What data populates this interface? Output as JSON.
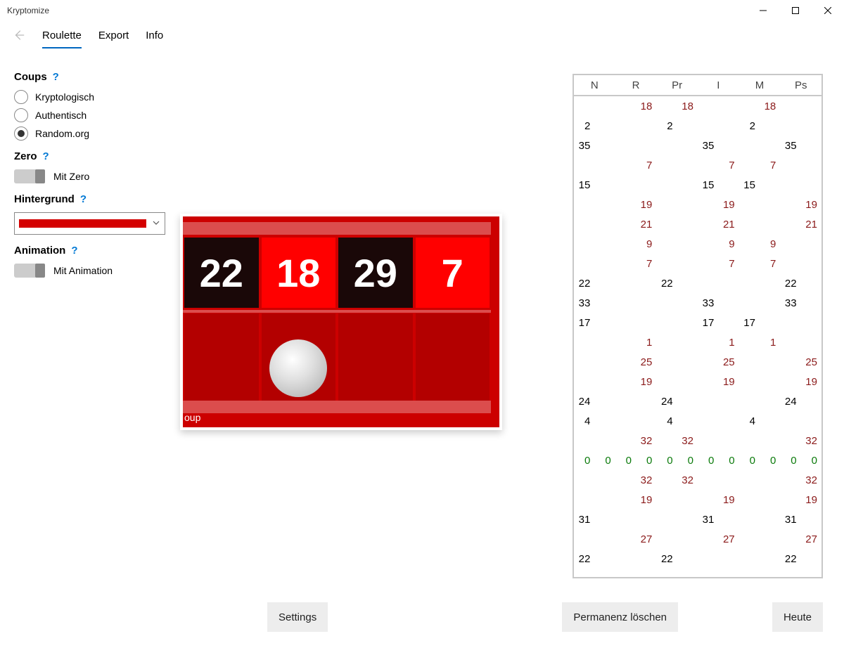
{
  "app_title": "Kryptomize",
  "tabs": [
    "Roulette",
    "Export",
    "Info"
  ],
  "active_tab": 0,
  "sidebar": {
    "coups": {
      "title": "Coups",
      "options": [
        "Kryptologisch",
        "Authentisch",
        "Random.org"
      ],
      "selected": 2
    },
    "zero": {
      "title": "Zero",
      "toggle_label": "Mit Zero",
      "enabled": false
    },
    "background": {
      "title": "Hintergrund",
      "color": "#d40000"
    },
    "animation": {
      "title": "Animation",
      "toggle_label": "Mit Animation",
      "enabled": false
    }
  },
  "roulette_strip": {
    "cells": [
      {
        "n": "22",
        "color": "black"
      },
      {
        "n": "18",
        "color": "red"
      },
      {
        "n": "29",
        "color": "black"
      },
      {
        "n": "7",
        "color": "red"
      }
    ],
    "ball_index": 1,
    "label_fragment": "oup"
  },
  "table": {
    "headers": [
      "N",
      "R",
      "Pr",
      "I",
      "M",
      "Ps"
    ],
    "rows": [
      [
        "",
        "18",
        "18",
        "",
        "18",
        ""
      ],
      [
        "2",
        "",
        "2",
        "",
        "2",
        ""
      ],
      [
        "35",
        "",
        "",
        "35",
        "",
        "35"
      ],
      [
        "",
        "7",
        "",
        "7",
        "7",
        ""
      ],
      [
        "15",
        "",
        "",
        "15",
        "15",
        ""
      ],
      [
        "",
        "19",
        "",
        "19",
        "",
        "19"
      ],
      [
        "",
        "21",
        "",
        "21",
        "",
        "21"
      ],
      [
        "",
        "9",
        "",
        "9",
        "9",
        ""
      ],
      [
        "",
        "7",
        "",
        "7",
        "7",
        ""
      ],
      [
        "22",
        "",
        "22",
        "",
        "",
        "22"
      ],
      [
        "33",
        "",
        "",
        "33",
        "",
        "33"
      ],
      [
        "17",
        "",
        "",
        "17",
        "17",
        ""
      ],
      [
        "",
        "1",
        "",
        "1",
        "1",
        ""
      ],
      [
        "",
        "25",
        "",
        "25",
        "",
        "25"
      ],
      [
        "",
        "19",
        "",
        "19",
        "",
        "19"
      ],
      [
        "24",
        "",
        "24",
        "",
        "",
        "24"
      ],
      [
        "4",
        "",
        "4",
        "",
        "4",
        ""
      ],
      [
        "",
        "32",
        "32",
        "",
        "",
        "32"
      ],
      [
        "0g",
        "0g",
        "0g",
        "0g",
        "0g",
        "0g"
      ],
      [
        "",
        "32",
        "32",
        "",
        "",
        "32"
      ],
      [
        "",
        "19",
        "",
        "19",
        "",
        "19"
      ],
      [
        "31",
        "",
        "",
        "31",
        "",
        "31"
      ],
      [
        "",
        "27",
        "",
        "27",
        "",
        "27"
      ],
      [
        "22",
        "",
        "22",
        "",
        "",
        "22"
      ]
    ]
  },
  "buttons": {
    "settings": "Settings",
    "clear_perm": "Permanenz löschen",
    "today": "Heute"
  }
}
